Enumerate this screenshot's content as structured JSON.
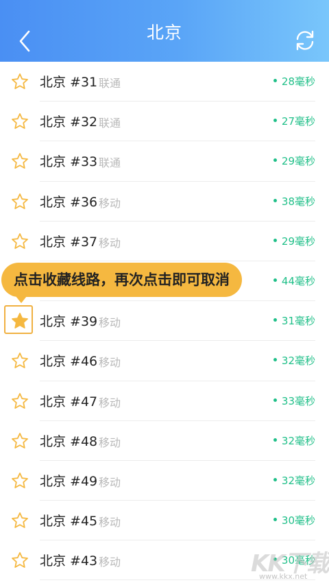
{
  "header": {
    "title": "北京"
  },
  "rows": [
    {
      "name": "北京 #31",
      "carrier": "联通",
      "latency": "28毫秒",
      "favorited": false
    },
    {
      "name": "北京 #32",
      "carrier": "联通",
      "latency": "27毫秒",
      "favorited": false
    },
    {
      "name": "北京 #33",
      "carrier": "联通",
      "latency": "29毫秒",
      "favorited": false
    },
    {
      "name": "北京 #36",
      "carrier": "移动",
      "latency": "38毫秒",
      "favorited": false
    },
    {
      "name": "北京 #37",
      "carrier": "移动",
      "latency": "29毫秒",
      "favorited": false
    },
    {
      "name": "",
      "carrier": "",
      "latency": "44毫秒",
      "favorited": false
    },
    {
      "name": "北京 #39",
      "carrier": "移动",
      "latency": "31毫秒",
      "favorited": true
    },
    {
      "name": "北京 #46",
      "carrier": "移动",
      "latency": "32毫秒",
      "favorited": false
    },
    {
      "name": "北京 #47",
      "carrier": "移动",
      "latency": "33毫秒",
      "favorited": false
    },
    {
      "name": "北京 #48",
      "carrier": "移动",
      "latency": "32毫秒",
      "favorited": false
    },
    {
      "name": "北京 #49",
      "carrier": "移动",
      "latency": "32毫秒",
      "favorited": false
    },
    {
      "name": "北京 #45",
      "carrier": "移动",
      "latency": "30毫秒",
      "favorited": false
    },
    {
      "name": "北京 #43",
      "carrier": "移动",
      "latency": "30毫秒",
      "favorited": false
    }
  ],
  "tooltip": {
    "text": "点击收藏线路，再次点击即可取消"
  },
  "watermark": {
    "logo": "KK下载",
    "url": "www.kkx.net"
  },
  "colors": {
    "accent": "#4a8ff3",
    "latency": "#1fbf88",
    "star": "#f5b840"
  },
  "icons": {
    "back": "chevron-left-icon",
    "refresh": "refresh-icon",
    "star": "star-icon"
  }
}
